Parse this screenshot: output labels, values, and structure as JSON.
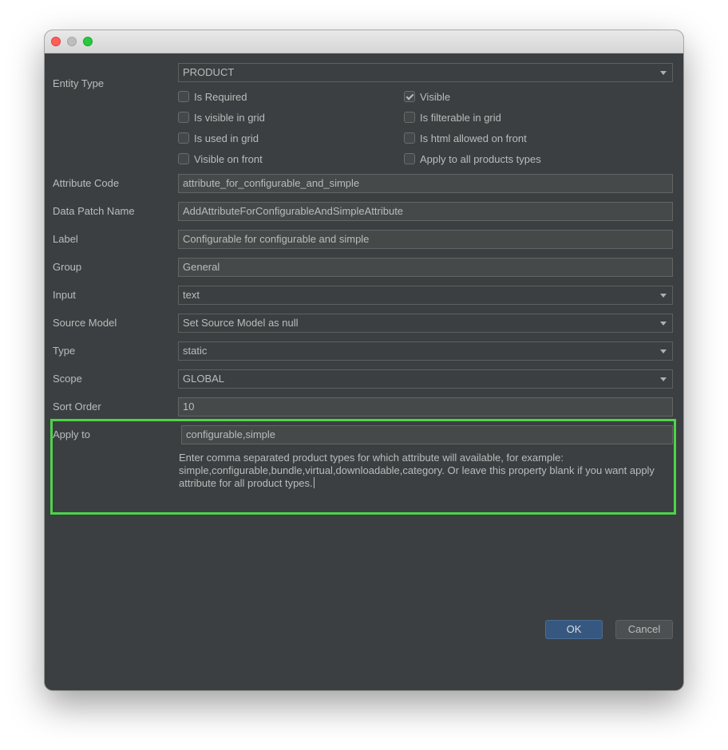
{
  "dialog": {
    "entity_type": {
      "label": "Entity Type",
      "value": "PRODUCT"
    },
    "checkboxes": {
      "is_required": {
        "label": "Is Required",
        "checked": false
      },
      "visible": {
        "label": "Visible",
        "checked": true
      },
      "is_visible_in_grid": {
        "label": "Is visible in grid",
        "checked": false
      },
      "is_filterable_in_grid": {
        "label": "Is filterable in grid",
        "checked": false
      },
      "is_used_in_grid": {
        "label": "Is used in grid",
        "checked": false
      },
      "is_html_allowed_on_front": {
        "label": "Is html allowed on front",
        "checked": false
      },
      "visible_on_front": {
        "label": "Visible on front",
        "checked": false
      },
      "apply_to_all_products_types": {
        "label": "Apply to all products types",
        "checked": false
      }
    },
    "fields": {
      "attribute_code": {
        "label": "Attribute Code",
        "value": "attribute_for_configurable_and_simple"
      },
      "data_patch_name": {
        "label": "Data Patch Name",
        "value": "AddAttributeForConfigurableAndSimpleAttribute"
      },
      "label": {
        "label": "Label",
        "value": "Configurable for configurable and simple"
      },
      "group": {
        "label": "Group",
        "value": "General"
      },
      "input": {
        "label": "Input",
        "value": "text"
      },
      "source_model": {
        "label": "Source Model",
        "value": "Set Source Model as null"
      },
      "type": {
        "label": "Type",
        "value": "static"
      },
      "scope": {
        "label": "Scope",
        "value": "GLOBAL"
      },
      "sort_order": {
        "label": "Sort Order",
        "value": "10"
      },
      "apply_to": {
        "label": "Apply to",
        "value": "configurable,simple",
        "hint": "Enter comma separated product types for which attribute will available, for example: simple,configurable,bundle,virtual,downloadable,category. Or leave this property blank if you want apply attribute for all product types."
      }
    },
    "buttons": {
      "ok": "OK",
      "cancel": "Cancel"
    }
  },
  "colors": {
    "dialog_background": "#3c3f41",
    "field_background": "#45494a",
    "text": "#bbbbbb",
    "primary_button": "#365880",
    "highlight": "#4bd44a",
    "close_button": "#fe5f57",
    "zoom_button": "#28c840"
  },
  "icons": {
    "dropdown": "chevron-down-icon",
    "checkmark": "checkmark-icon",
    "close": "close-traffic-light-icon",
    "minimize": "minimize-traffic-light-icon",
    "zoom": "zoom-traffic-light-icon"
  }
}
